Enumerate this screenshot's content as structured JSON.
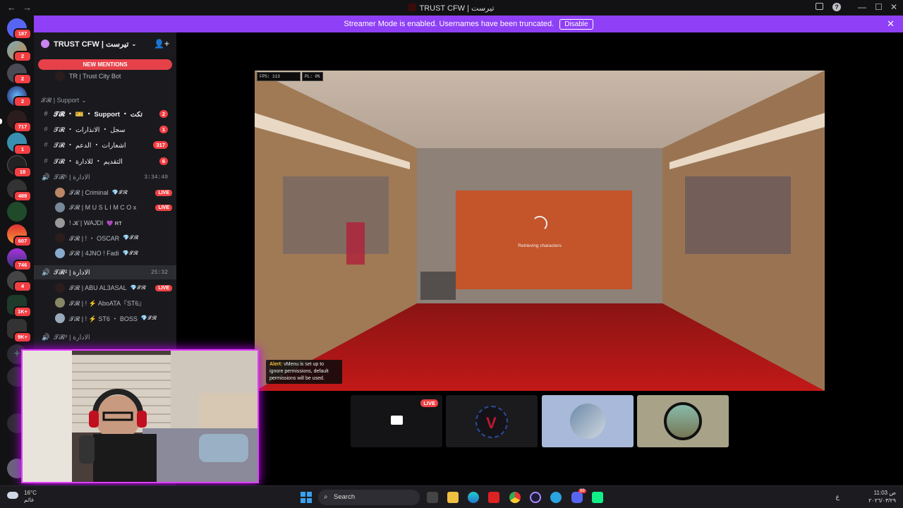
{
  "window": {
    "title": "TRUST CFW | تيرست",
    "back": "←",
    "forward": "→",
    "help": "?",
    "minimize": "—",
    "maximize": "☐",
    "close": "✕"
  },
  "banner": {
    "text": "Streamer Mode is enabled. Usernames have been truncated.",
    "disable_label": "Disable",
    "close": "✕"
  },
  "guild_badges": [
    "187",
    "2",
    "2",
    "2",
    "717",
    "1",
    "18",
    "488",
    "607",
    "746",
    "4",
    "1K+",
    "9K+"
  ],
  "server": {
    "name": "TRUST CFW | تيرست",
    "new_mentions": "NEW MENTIONS",
    "bot": "TR | Trust City Bot"
  },
  "channels": {
    "category": "𝓣𝓡 | Support",
    "items": [
      {
        "name": "𝓣𝓡 ・ 🎫 ・ Support ・ تكت",
        "badge": "2"
      },
      {
        "name": "𝓣𝓡 ・ سجل ・ الانذارات",
        "badge": "1"
      },
      {
        "name": "𝓣𝓡 ・ اشعارات ・ الدعم",
        "badge": "317"
      },
      {
        "name": "𝓣𝓡 ・ التقديم ・ للادارة",
        "badge": "6"
      }
    ],
    "voice1": {
      "name": "𝓣𝓡¹ | الادارة",
      "time": "3:34:40"
    },
    "voice1_users": [
      {
        "name": "𝓣𝓡 | Criminal",
        "tag": "💎𝓣𝓡",
        "live": "LIVE"
      },
      {
        "name": "𝓣𝓡 | M U S L I M C O x",
        "tag": "",
        "live": "LIVE"
      },
      {
        "name": "! 𝓚 | WAJDI",
        "tag": "💜 RT",
        "live": ""
      },
      {
        "name": "𝓣𝓡 | ! ・ OSCAR",
        "tag": "💎𝓣𝓡",
        "live": ""
      },
      {
        "name": "𝓣𝓡 | 4JNO ! Fadi",
        "tag": "💎𝓣𝓡",
        "live": ""
      }
    ],
    "voice2": {
      "name": "𝓣𝓡² | الادارة",
      "time": "25:32"
    },
    "voice2_users": [
      {
        "name": "𝓣𝓡 | ABU AL3ASAL",
        "tag": "💎𝓣𝓡",
        "live": "LIVE"
      },
      {
        "name": "𝓣𝓡 | ! ⚡ AboATA『ST6』",
        "tag": "",
        "live": ""
      },
      {
        "name": "𝓣𝓡 | ! ⚡ ST6 ・ BOSS",
        "tag": "💎𝓣𝓡",
        "live": ""
      }
    ],
    "voice3": {
      "name": "𝓣𝓡³ | الادارة"
    }
  },
  "stream": {
    "fps": "FPS: 113",
    "pl": "PL: 0%",
    "loading_text": "Retrieving characters",
    "alert_label": "Alert:",
    "alert_text": "vMenu is set up to ignore permissions, default permissions will be used."
  },
  "tiles": {
    "live_badge": "LIVE"
  },
  "taskbar": {
    "temp": "16°C",
    "weather": "غائم",
    "search": "Search",
    "lang": "ع",
    "time": "11:03 ص",
    "date": "٢٠٢٦/٠٣/٢٩",
    "discord_badge": "99"
  },
  "colors": {
    "banner": "#8f40f6",
    "badge": "#f23f43",
    "cam_border": "#e040fb"
  }
}
